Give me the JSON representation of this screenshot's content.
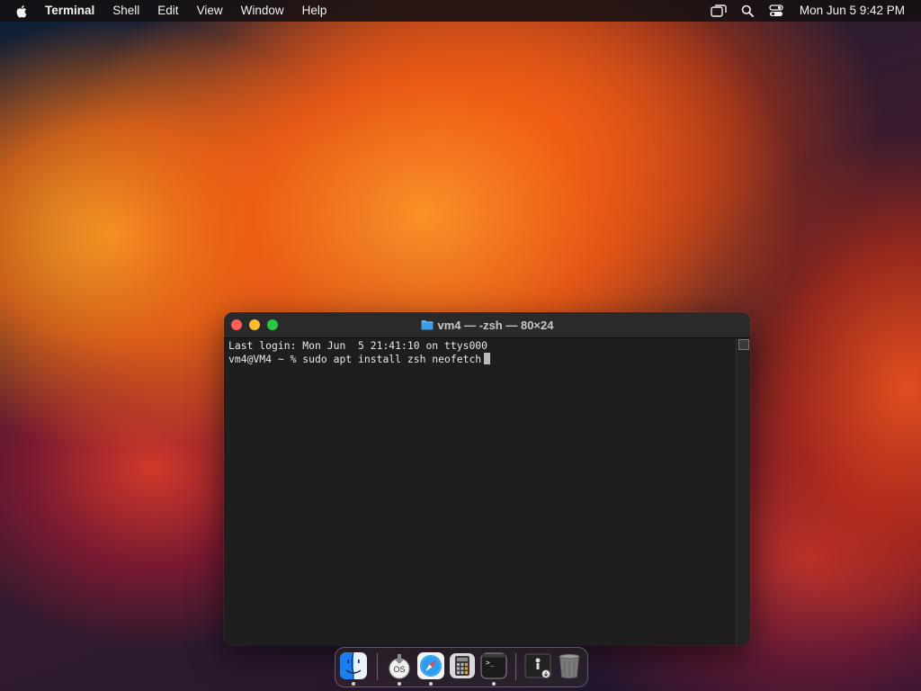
{
  "menubar": {
    "app_name": "Terminal",
    "menus": [
      "Shell",
      "Edit",
      "View",
      "Window",
      "Help"
    ],
    "icons": [
      "apple-icon",
      "screen-mirroring-icon",
      "search-icon",
      "control-center-icon"
    ],
    "clock": "Mon Jun 5  9:42 PM"
  },
  "terminal": {
    "title": "vm4 — -zsh — 80×24",
    "lines": [
      "Last login: Mon Jun  5 21:41:10 on ttys000",
      "vm4@VM4 ~ % sudo apt install zsh neofetch"
    ],
    "colors": {
      "close": "#ff5f57",
      "minimize": "#febc2e",
      "zoom": "#28c840"
    }
  },
  "dock": {
    "items": [
      "Finder",
      "macOS Installer",
      "Safari",
      "Calculator",
      "Terminal",
      "Downloads",
      "Trash"
    ],
    "icons": [
      "finder-icon",
      "macos-installer-icon",
      "safari-icon",
      "calculator-icon",
      "terminal-icon",
      "downloads-stack-icon",
      "trash-icon"
    ],
    "label_os": "OS",
    "terminal_prompt": ">_"
  }
}
